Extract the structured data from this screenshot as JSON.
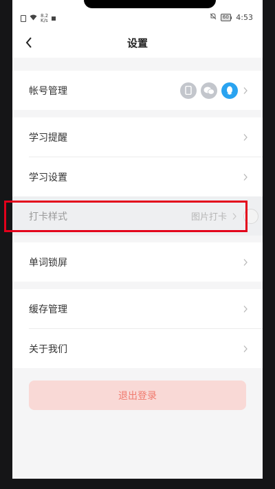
{
  "status_bar": {
    "network_speed_value": "8.2",
    "network_speed_unit": "K/s",
    "battery": "60",
    "time": "4:53"
  },
  "header": {
    "title": "设置"
  },
  "groups": {
    "account": {
      "label": "帐号管理"
    },
    "study": {
      "reminder_label": "学习提醒",
      "settings_label": "学习设置",
      "checkin_label": "打卡样式",
      "checkin_value": "图片打卡"
    },
    "lock": {
      "label": "单词锁屏"
    },
    "misc": {
      "cache_label": "缓存管理",
      "about_label": "关于我们"
    }
  },
  "logout_label": "退出登录",
  "colors": {
    "accent_blue": "#2aa3f0",
    "logout_bg": "#f9d9d6",
    "logout_text": "#f07a6e",
    "highlight_border": "#e3001b"
  }
}
